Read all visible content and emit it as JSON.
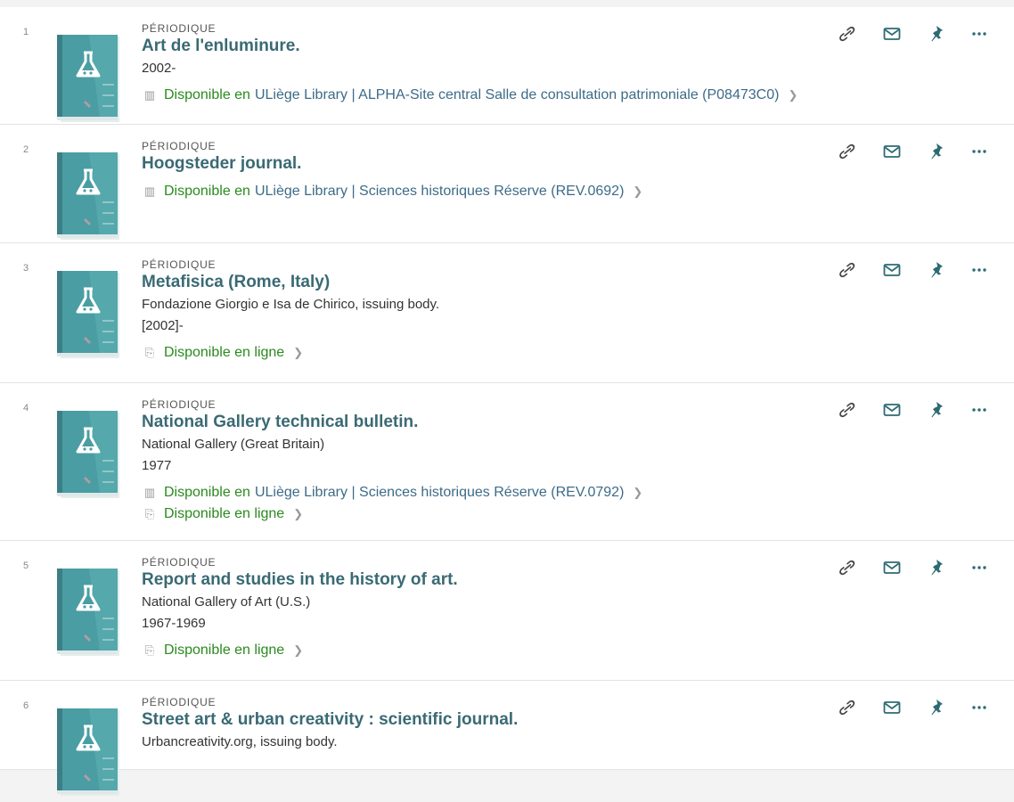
{
  "colors": {
    "title": "#3a6a74",
    "available": "#2a8a1e",
    "location": "#3d6b88",
    "icon": "#2d6b73",
    "thumbnail": "#4a9da3"
  },
  "icons": {
    "thumbnail": "journal-flask-icon",
    "link": "link-icon",
    "mail": "mail-icon",
    "pin": "pin-icon",
    "more": "more-icon",
    "physical": "book-icon",
    "online": "link-icon",
    "chevron": "chevron-right-icon"
  },
  "results": [
    {
      "number": "1",
      "type": "PÉRIODIQUE",
      "title": "Art de l'enluminure.",
      "lines": [
        "2002-"
      ],
      "availability": [
        {
          "kind": "physical",
          "status": "Disponible en",
          "location": "ULiège Library | ALPHA-Site central  Salle de consultation patrimoniale (P08473C0)"
        }
      ]
    },
    {
      "number": "2",
      "type": "PÉRIODIQUE",
      "title": "Hoogsteder journal.",
      "lines": [],
      "availability": [
        {
          "kind": "physical",
          "status": "Disponible en",
          "location": "ULiège Library | Sciences historiques  Réserve (REV.0692)"
        }
      ]
    },
    {
      "number": "3",
      "type": "PÉRIODIQUE",
      "title": "Metafisica (Rome, Italy)",
      "lines": [
        "Fondazione Giorgio e Isa de Chirico, issuing body.",
        "[2002]-"
      ],
      "availability": [
        {
          "kind": "online",
          "status": "Disponible en ligne",
          "location": ""
        }
      ]
    },
    {
      "number": "4",
      "type": "PÉRIODIQUE",
      "title": "National Gallery technical bulletin.",
      "lines": [
        "National Gallery (Great Britain)",
        "1977"
      ],
      "availability": [
        {
          "kind": "physical",
          "status": "Disponible en",
          "location": "ULiège Library | Sciences historiques  Réserve (REV.0792)"
        },
        {
          "kind": "online",
          "status": "Disponible en ligne",
          "location": ""
        }
      ]
    },
    {
      "number": "5",
      "type": "PÉRIODIQUE",
      "title": "Report and studies in the history of art.",
      "lines": [
        "National Gallery of Art (U.S.)",
        "1967-1969"
      ],
      "availability": [
        {
          "kind": "online",
          "status": "Disponible en ligne",
          "location": ""
        }
      ]
    },
    {
      "number": "6",
      "type": "PÉRIODIQUE",
      "title": "Street art & urban creativity : scientific journal.",
      "lines": [
        "Urbancreativity.org, issuing body."
      ],
      "availability": []
    }
  ]
}
